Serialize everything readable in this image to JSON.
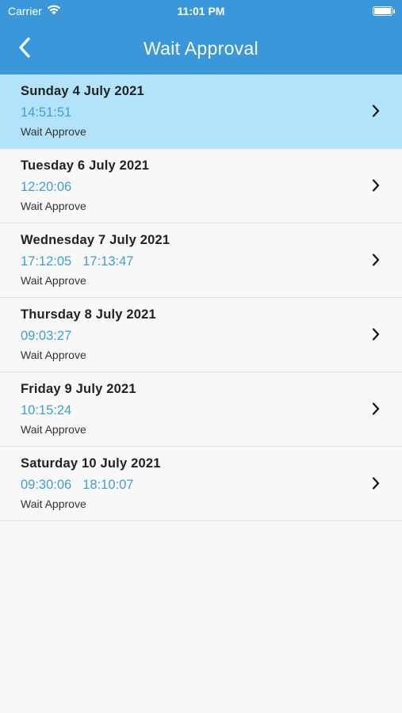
{
  "status_bar": {
    "carrier": "Carrier",
    "time": "11:01 PM",
    "icons": [
      "wifi-icon",
      "battery-icon"
    ]
  },
  "nav": {
    "title": "Wait Approval",
    "back_icon": "chevron-left-icon"
  },
  "colors": {
    "primary": "#3a97d9",
    "selected_row": "#b3e3fa",
    "time_text": "#3e9fd3"
  },
  "items": [
    {
      "date": "Sunday 4 July 2021",
      "times": [
        "14:51:51"
      ],
      "status": "Wait Approve",
      "selected": true
    },
    {
      "date": "Tuesday 6 July 2021",
      "times": [
        "12:20:06"
      ],
      "status": "Wait Approve",
      "selected": false
    },
    {
      "date": "Wednesday 7 July 2021",
      "times": [
        "17:12:05",
        "17:13:47"
      ],
      "status": "Wait Approve",
      "selected": false
    },
    {
      "date": "Thursday 8 July 2021",
      "times": [
        "09:03:27"
      ],
      "status": "Wait Approve",
      "selected": false
    },
    {
      "date": "Friday 9 July 2021",
      "times": [
        "10:15:24"
      ],
      "status": "Wait Approve",
      "selected": false
    },
    {
      "date": "Saturday 10 July 2021",
      "times": [
        "09:30:06",
        "18:10:07"
      ],
      "status": "Wait Approve",
      "selected": false
    }
  ]
}
